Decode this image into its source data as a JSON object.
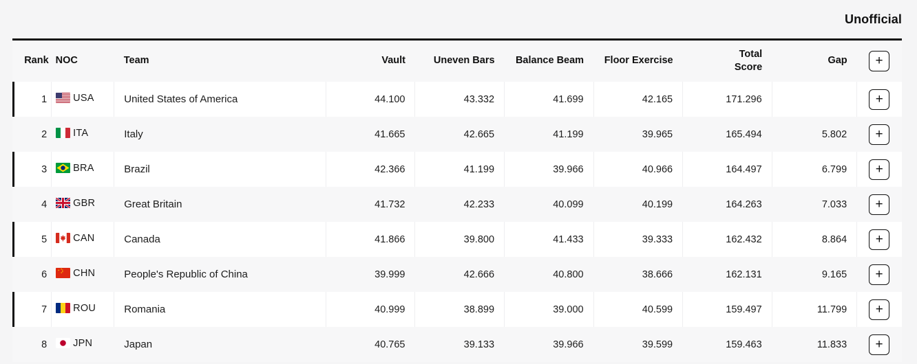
{
  "header": {
    "status_label": "Unofficial"
  },
  "table": {
    "columns": [
      {
        "key": "rank",
        "label": "Rank",
        "align": "right"
      },
      {
        "key": "noc",
        "label": "NOC",
        "align": "left"
      },
      {
        "key": "team",
        "label": "Team",
        "align": "left"
      },
      {
        "key": "vault",
        "label": "Vault",
        "align": "right"
      },
      {
        "key": "bars",
        "label": "Uneven Bars",
        "align": "right"
      },
      {
        "key": "beam",
        "label": "Balance Beam",
        "align": "right"
      },
      {
        "key": "floor",
        "label": "Floor Exercise",
        "align": "right"
      },
      {
        "key": "total",
        "label": "Total Score",
        "align": "right"
      },
      {
        "key": "gap",
        "label": "Gap",
        "align": "right"
      },
      {
        "key": "action",
        "label": "+",
        "align": "center"
      }
    ],
    "header": {
      "rank": "Rank",
      "noc": "NOC",
      "team": "Team",
      "vault": "Vault",
      "bars": "Uneven Bars",
      "beam": "Balance Beam",
      "floor": "Floor Exercise",
      "total_line1": "Total",
      "total_line2": "Score",
      "gap": "Gap",
      "expand_all": "+"
    },
    "rows": [
      {
        "rank": "1",
        "noc": "USA",
        "flag": "flag-usa",
        "team": "United States of America",
        "vault": "44.100",
        "bars": "43.332",
        "beam": "41.699",
        "floor": "42.165",
        "total": "171.296",
        "gap": "",
        "action": "+"
      },
      {
        "rank": "2",
        "noc": "ITA",
        "flag": "flag-ita",
        "team": "Italy",
        "vault": "41.665",
        "bars": "42.665",
        "beam": "41.199",
        "floor": "39.965",
        "total": "165.494",
        "gap": "5.802",
        "action": "+"
      },
      {
        "rank": "3",
        "noc": "BRA",
        "flag": "flag-bra",
        "team": "Brazil",
        "vault": "42.366",
        "bars": "41.199",
        "beam": "39.966",
        "floor": "40.966",
        "total": "164.497",
        "gap": "6.799",
        "action": "+"
      },
      {
        "rank": "4",
        "noc": "GBR",
        "flag": "flag-gbr",
        "team": "Great Britain",
        "vault": "41.732",
        "bars": "42.233",
        "beam": "40.099",
        "floor": "40.199",
        "total": "164.263",
        "gap": "7.033",
        "action": "+"
      },
      {
        "rank": "5",
        "noc": "CAN",
        "flag": "flag-can",
        "team": "Canada",
        "vault": "41.866",
        "bars": "39.800",
        "beam": "41.433",
        "floor": "39.333",
        "total": "162.432",
        "gap": "8.864",
        "action": "+"
      },
      {
        "rank": "6",
        "noc": "CHN",
        "flag": "flag-chn",
        "team": "People's Republic of China",
        "vault": "39.999",
        "bars": "42.666",
        "beam": "40.800",
        "floor": "38.666",
        "total": "162.131",
        "gap": "9.165",
        "action": "+"
      },
      {
        "rank": "7",
        "noc": "ROU",
        "flag": "flag-rou",
        "team": "Romania",
        "vault": "40.999",
        "bars": "38.899",
        "beam": "39.000",
        "floor": "40.599",
        "total": "159.497",
        "gap": "11.799",
        "action": "+"
      },
      {
        "rank": "8",
        "noc": "JPN",
        "flag": "flag-jpn",
        "team": "Japan",
        "vault": "40.765",
        "bars": "39.133",
        "beam": "39.966",
        "floor": "39.599",
        "total": "159.463",
        "gap": "11.833",
        "action": "+"
      }
    ]
  },
  "colors": {
    "page_background": "#f5f5f6",
    "row_white": "#ffffff",
    "row_stripe": "#f7f7f8",
    "rule": "#111111",
    "text": "#1c1c1c"
  }
}
